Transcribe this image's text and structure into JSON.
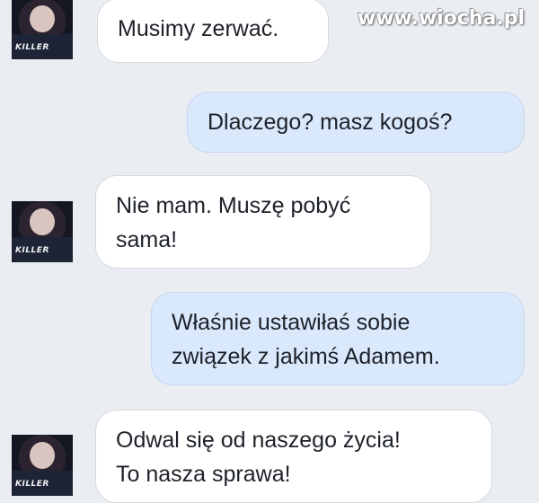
{
  "watermark": "www.wiocha.pl",
  "avatar": {
    "shirt_text": "KILLER"
  },
  "messages": [
    {
      "direction": "received",
      "lines": [
        "Musimy zerwać."
      ]
    },
    {
      "direction": "sent",
      "lines": [
        "Dlaczego? masz kogoś?"
      ]
    },
    {
      "direction": "received",
      "lines": [
        "Nie mam. Muszę pobyć",
        "sama!"
      ]
    },
    {
      "direction": "sent",
      "lines": [
        "Właśnie ustawiłaś sobie",
        "związek z jakimś Adamem."
      ]
    },
    {
      "direction": "received",
      "lines": [
        "Odwal się od naszego życia!",
        "To nasza sprawa!"
      ]
    }
  ]
}
